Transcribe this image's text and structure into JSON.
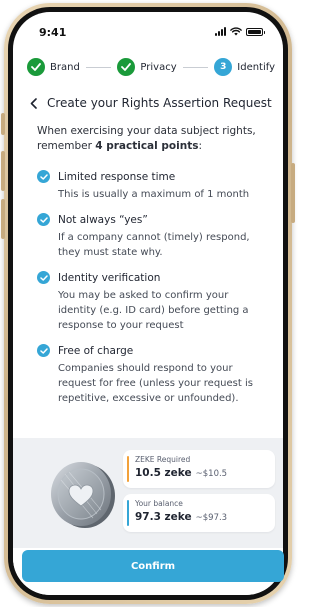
{
  "status_bar": {
    "time": "9:41"
  },
  "stepper": {
    "steps": [
      {
        "label": "Brand",
        "state": "done"
      },
      {
        "label": "Privacy",
        "state": "done"
      },
      {
        "label": "Identify",
        "state": "current",
        "number": "3"
      }
    ]
  },
  "header": {
    "title": "Create your Rights Assertion Request"
  },
  "intro": {
    "text": "When exercising your data subject rights, remember ",
    "emphasis": "4 practical points",
    "suffix": ":"
  },
  "points": [
    {
      "title": "Limited response time",
      "description": "This is usually a maximum of 1 month"
    },
    {
      "title": "Not always “yes”",
      "description": "If a company cannot (timely) respond, they must state why."
    },
    {
      "title": "Identity verification",
      "description": "You may be asked to confirm your identity (e.g. ID card) before getting a response to your request"
    },
    {
      "title": "Free of charge",
      "description": "Companies should respond to your request for free (unless your request is repetitive, excessive or unfounded)."
    }
  ],
  "summary": {
    "required_label": "ZEKE Required",
    "required_value": "10.5 zeke",
    "required_fiat": "~$10.5",
    "balance_label": "Your balance",
    "balance_value": "97.3 zeke",
    "balance_fiat": "~$97.3"
  },
  "confirm_label": "Confirm",
  "colors": {
    "accent": "#35a6d6",
    "success": "#1a9a3a",
    "warning": "#f2a13a"
  }
}
